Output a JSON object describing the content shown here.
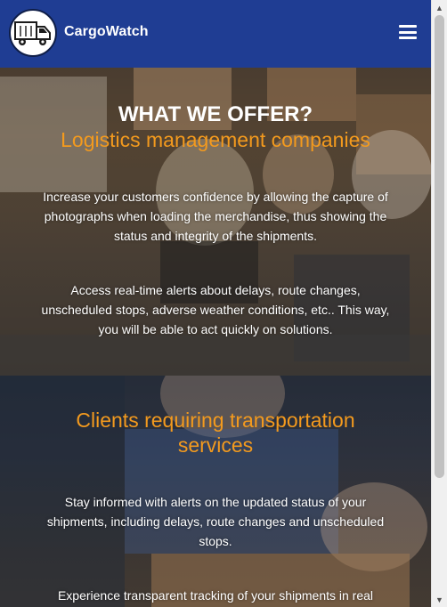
{
  "header": {
    "brand": "CargoWatch",
    "logo_icon": "truck-icon",
    "menu_icon": "hamburger-menu-icon",
    "background": "#1f3d93"
  },
  "offer": {
    "title": "WHAT WE OFFER?",
    "logistics": {
      "subtitle": "Logistics management companies",
      "paragraphs": [
        "Increase your customers confidence by allowing the capture of photographs when loading the merchandise, thus showing the status and integrity of the shipments.",
        "Access real-time alerts about delays, route changes, unscheduled stops, adverse weather conditions, etc.. This way, you will be able to act quickly on solutions."
      ]
    },
    "clients": {
      "subtitle": "Clients requiring transportation services",
      "paragraphs": [
        "Stay informed with alerts on the updated status of your shipments, including delays, route changes and unscheduled stops.",
        "Experience transparent tracking of your shipments in real"
      ]
    }
  },
  "colors": {
    "accent": "#f39a1e",
    "header": "#1f3d93",
    "text": "#ffffff"
  }
}
